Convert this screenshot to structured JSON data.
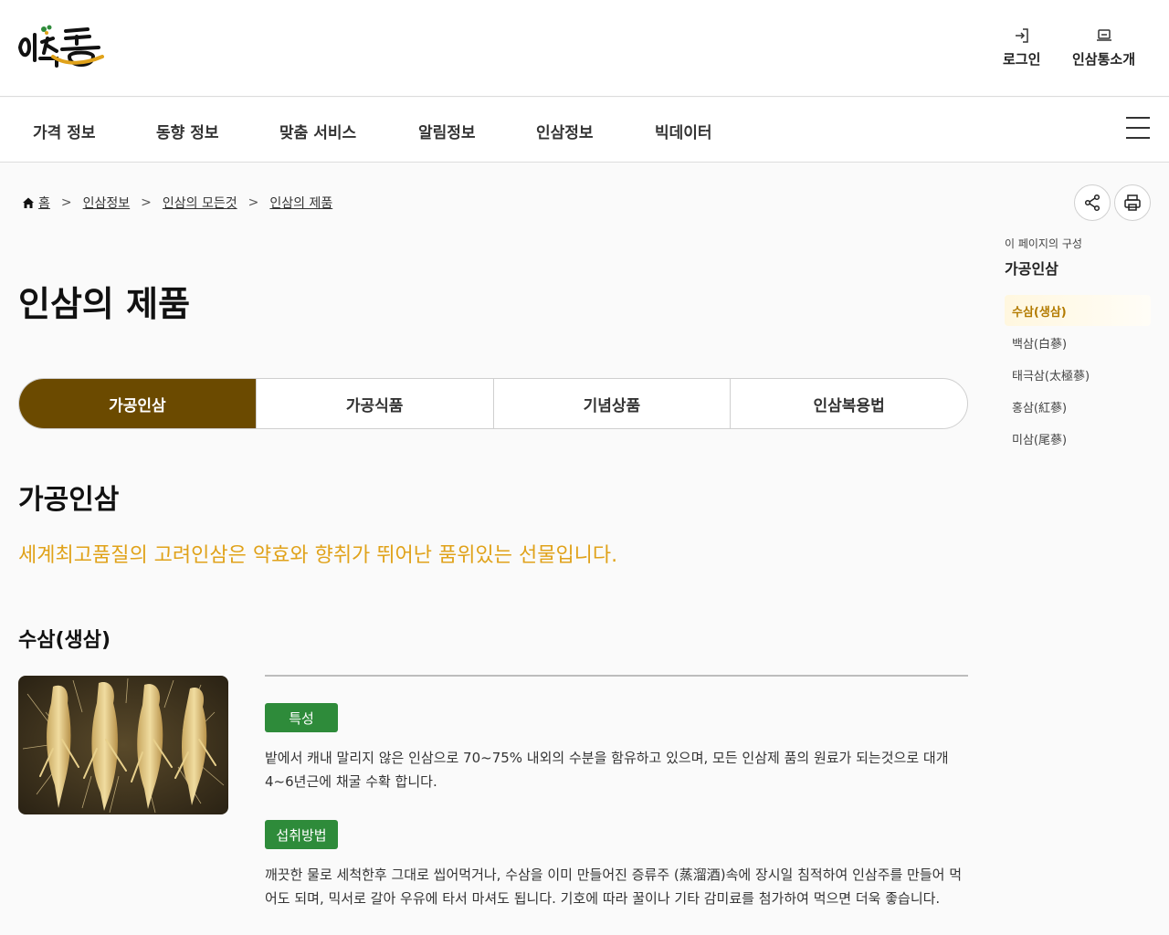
{
  "header": {
    "logo_text": "인삼통",
    "login_label": "로그인",
    "intro_label": "인삼통소개"
  },
  "gnb": {
    "items": [
      "가격 정보",
      "동향 정보",
      "맞춤 서비스",
      "알림정보",
      "인삼정보",
      "빅데이터"
    ]
  },
  "breadcrumb": {
    "home": "홈",
    "items": [
      "인삼정보",
      "인삼의 모든것",
      "인삼의 제품"
    ]
  },
  "page": {
    "title": "인삼의 제품"
  },
  "tabs": [
    {
      "label": "가공인삼",
      "active": true
    },
    {
      "label": "가공식품",
      "active": false
    },
    {
      "label": "기념상품",
      "active": false
    },
    {
      "label": "인삼복용법",
      "active": false
    }
  ],
  "content": {
    "section_title": "가공인삼",
    "tagline": "세계최고품질의 고려인삼은 약효와 향취가 뛰어난 품위있는 선물입니다.",
    "sub_title": "수삼(생삼)",
    "badge1": "특성",
    "desc1": "밭에서 캐내 말리지 않은 인삼으로 70~75% 내외의 수분을 함유하고 있으며, 모든 인삼제 품의 원료가 되는것으로 대개 4~6년근에 채굴 수확 합니다.",
    "badge2": "섭취방법",
    "desc2": "깨끗한 물로 세척한후 그대로 씹어먹거나, 수삼을 이미 만들어진 증류주 (蒸溜酒)속에 장시일 침적하여 인삼주를 만들어 먹어도 되며, 믹서로 갈아 우유에 타서 마셔도 됩니다. 기호에 따라 꿀이나 기타 감미료를 첨가하여 먹으면 더욱 좋습니다."
  },
  "toc": {
    "label": "이 페이지의 구성",
    "heading": "가공인삼",
    "items": [
      "수삼(생삼)",
      "백삼(白蔘)",
      "태극삼(太極蔘)",
      "홍삼(紅蔘)",
      "미삼(尾蔘)"
    ]
  },
  "colors": {
    "brand_brown": "#6b4a00",
    "accent_gold": "#e0a21a",
    "badge_green": "#2e8b3a"
  }
}
